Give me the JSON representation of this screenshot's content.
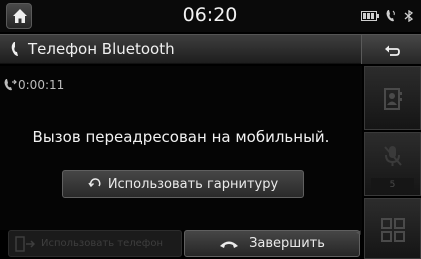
{
  "status": {
    "time": "06:20",
    "icons": [
      "battery-icon",
      "phone-call-icon",
      "bluetooth-icon"
    ]
  },
  "title": {
    "icon": "phone-handset-icon",
    "text": "Телефон Bluetooth",
    "back_icon": "back-arrow-icon"
  },
  "call": {
    "timer": "0:00:11",
    "message": "Вызов переадресован на мобильный.",
    "headset_button": "Использовать гарнитуру",
    "use_phone_button": "Использовать телефон",
    "end_button": "Завершить"
  },
  "sidebar": {
    "contacts_icon": "contacts-icon",
    "mute_icon": "microphone-mute-icon",
    "mute_level": "5",
    "keypad_icon": "keypad-icon"
  },
  "colors": {
    "background": "#000000",
    "button_top": "#464646",
    "button_bottom": "#262626",
    "disabled_text": "#3e3e3e"
  }
}
